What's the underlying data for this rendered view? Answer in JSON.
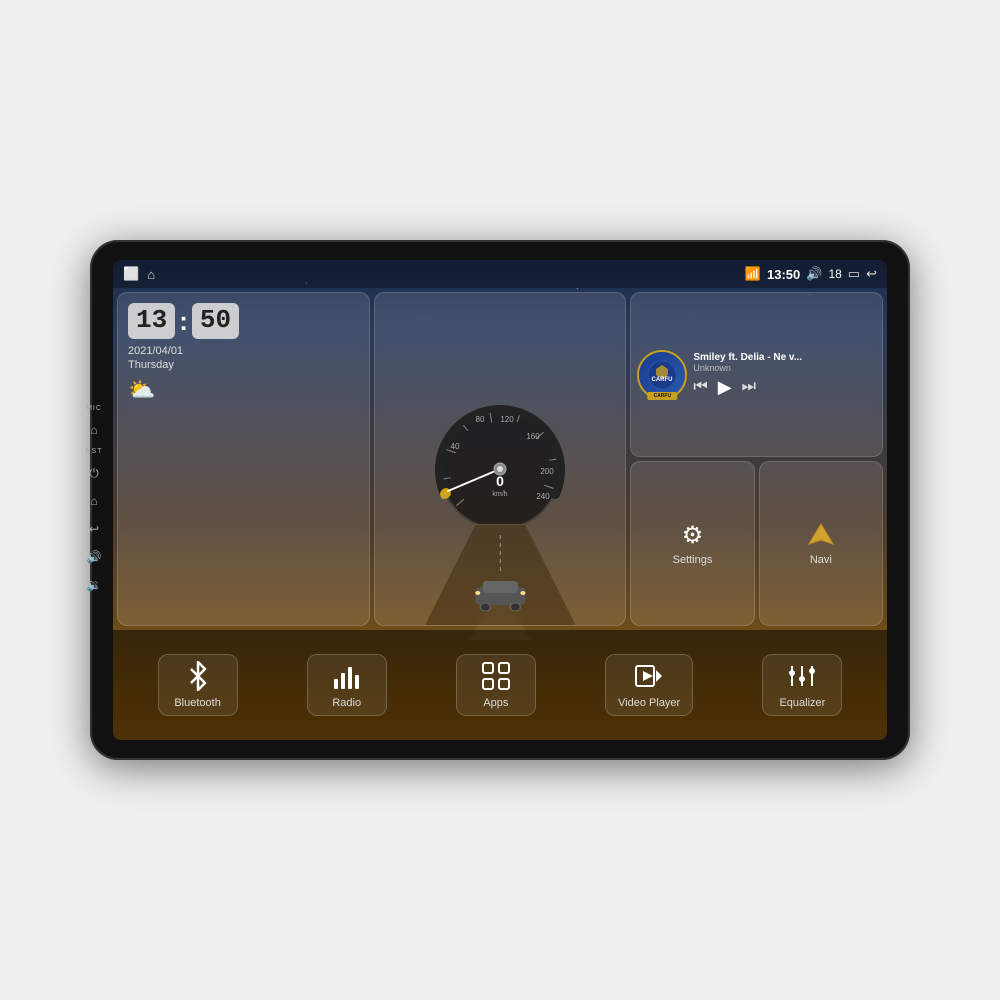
{
  "device": {
    "status_bar": {
      "mic_label": "MIC",
      "rst_label": "RST",
      "wifi_icon": "wifi",
      "time": "13:50",
      "volume_icon": "volume",
      "volume_level": "18",
      "window_icon": "window",
      "back_icon": "back"
    },
    "clock": {
      "hours": "13",
      "minutes": "50",
      "date": "2021/04/01",
      "day": "Thursday",
      "weather_icon": "⛅"
    },
    "speedometer": {
      "speed": "0",
      "unit": "km/h",
      "max": "240"
    },
    "music": {
      "logo_text": "CARFU",
      "ribbon_text": "CARFU",
      "title": "Smiley ft. Delia - Ne v...",
      "artist": "Unknown",
      "prev_icon": "⏮",
      "play_icon": "▶",
      "next_icon": "⏭"
    },
    "settings_widget": {
      "icon": "⚙",
      "label": "Settings"
    },
    "navi_widget": {
      "icon": "⬆",
      "label": "Navi"
    },
    "bottom_bar": {
      "buttons": [
        {
          "id": "bluetooth",
          "icon": "bluetooth",
          "label": "Bluetooth"
        },
        {
          "id": "radio",
          "icon": "radio",
          "label": "Radio"
        },
        {
          "id": "apps",
          "icon": "apps",
          "label": "Apps"
        },
        {
          "id": "video",
          "icon": "video",
          "label": "Video Player"
        },
        {
          "id": "equalizer",
          "icon": "equalizer",
          "label": "Equalizer"
        }
      ]
    }
  }
}
